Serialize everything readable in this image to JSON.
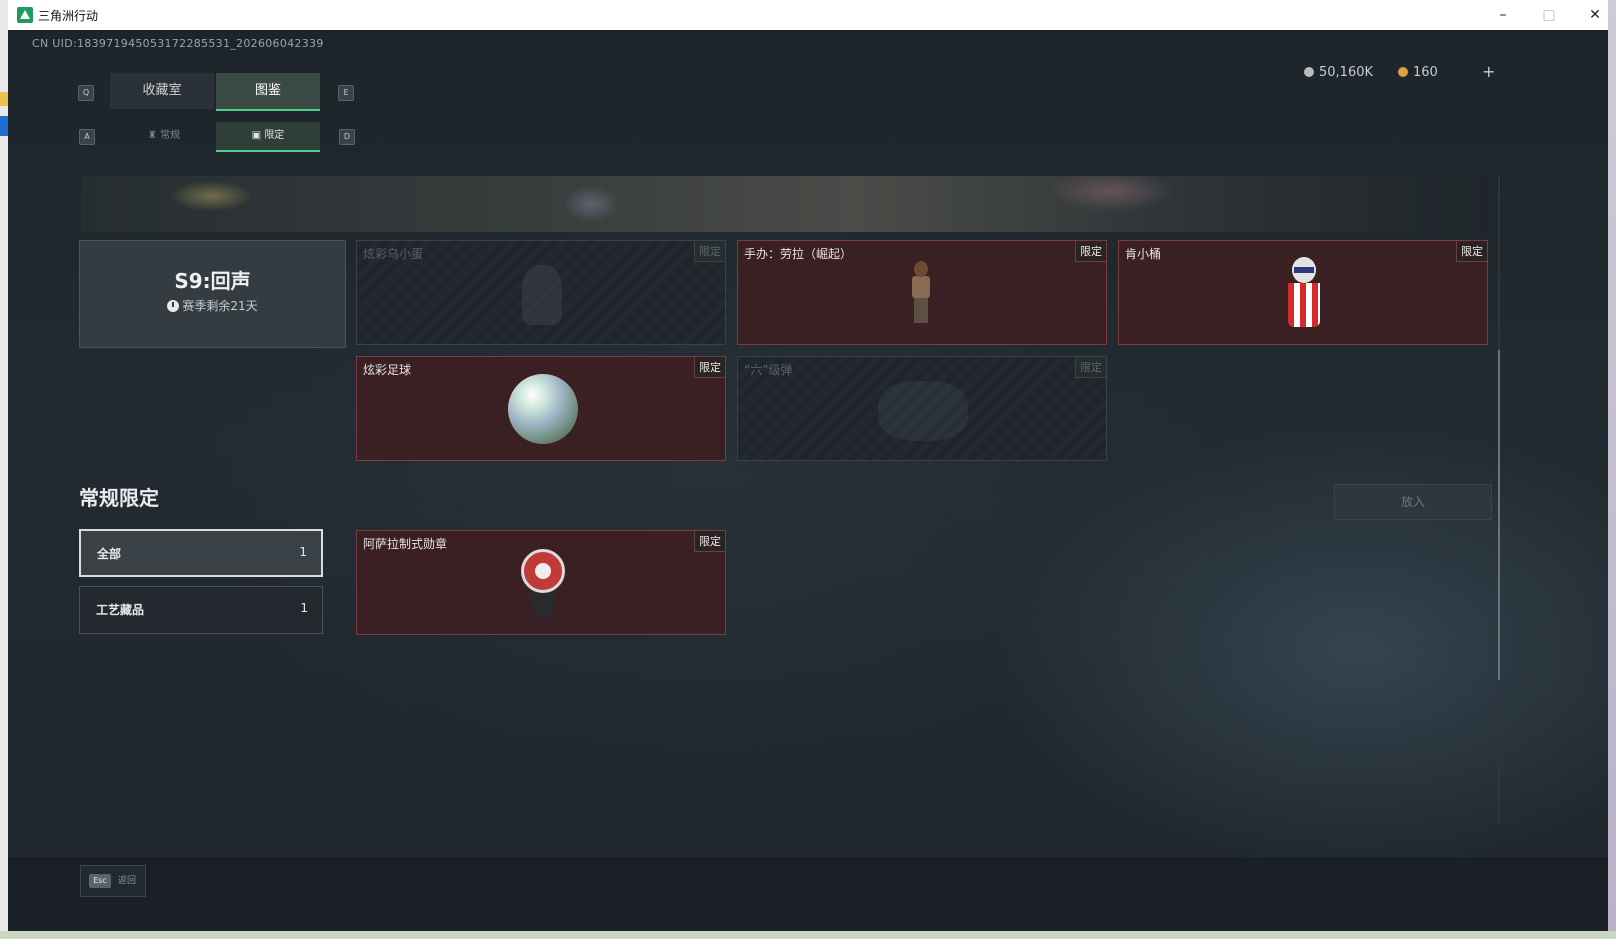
{
  "window": {
    "title": "三角洲行动",
    "controls": {
      "minimize": "–",
      "maximize": "□",
      "close": "✕"
    }
  },
  "header": {
    "uid": "CN UID:183971945053172285531_202606042339",
    "currency": [
      {
        "icon": "silver-coin-icon",
        "value": "50,160K"
      },
      {
        "icon": "gold-coin-icon",
        "value": "160"
      }
    ],
    "plus_label": "+"
  },
  "tabs": {
    "left_key": "Q",
    "right_key": "E",
    "items": [
      {
        "label": "收藏室",
        "active": false
      },
      {
        "label": "图鉴",
        "active": true
      }
    ]
  },
  "subtabs": {
    "left_key": "A",
    "right_key": "D",
    "items": [
      {
        "label": "常规",
        "icon": "bottle-icon",
        "active": false
      },
      {
        "label": "限定",
        "icon": "frame-icon",
        "active": true
      }
    ]
  },
  "season": {
    "name": "S9:回声",
    "remaining": "赛季剩余21天"
  },
  "season_items": [
    {
      "label": "炫彩乌小蛋",
      "badge": "限定",
      "owned": false
    },
    {
      "label": "手办：劳拉（崛起）",
      "badge": "限定",
      "owned": true
    },
    {
      "label": "肯小桶",
      "badge": "限定",
      "owned": true
    },
    {
      "label": "炫彩足球",
      "badge": "限定",
      "owned": true
    },
    {
      "label": "“六”级弹",
      "badge": "限定",
      "owned": false
    }
  ],
  "regular_section": {
    "title": "常规限定",
    "place_button": "放入",
    "filters": [
      {
        "label": "全部",
        "count": "1",
        "active": true
      },
      {
        "label": "工艺藏品",
        "count": "1",
        "active": false
      }
    ],
    "items": [
      {
        "label": "阿萨拉制式勋章",
        "badge": "限定",
        "owned": true
      }
    ]
  },
  "footer": {
    "esc_key": "Esc",
    "back_label": "返回"
  },
  "colors": {
    "accent": "#4fd18e",
    "owned_card": "#3a1f23",
    "background": "#1c2329"
  }
}
